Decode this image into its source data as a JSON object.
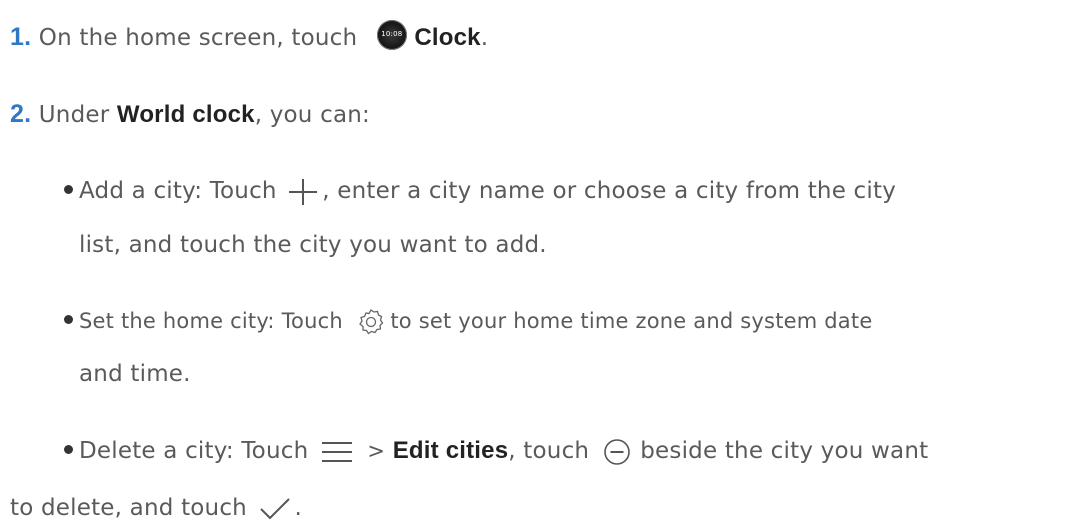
{
  "step1": {
    "number": "1.",
    "text": "On the home screen, touch",
    "icon_name": "clock-app-icon",
    "icon_time": "10:08",
    "app_name": "Clock",
    "end": "."
  },
  "step2": {
    "number": "2.",
    "text_a": "Under",
    "section_name": "World clock",
    "text_b": ", you can:"
  },
  "bullets": {
    "add_city": {
      "line1_a": "Add a city: Touch",
      "icon_name": "plus-icon",
      "line1_b": ", enter a city name or choose a city from the city",
      "line2": "list, and touch the city you want to add."
    },
    "home_city": {
      "line1_a": "Set the home city: Touch",
      "icon_name": "gear-icon",
      "line1_b": "to set your home time zone and system date",
      "line2": "and time."
    },
    "delete_city": {
      "line1_a": "Delete a city: Touch",
      "menu_icon_name": "menu-icon",
      "separator": ">",
      "edit_label": "Edit cities",
      "line1_b": ", touch",
      "remove_icon_name": "remove-icon",
      "line1_c": "beside the city you want",
      "line2_a": "to delete, and touch",
      "check_icon_name": "check-icon",
      "line2_b": "."
    }
  }
}
